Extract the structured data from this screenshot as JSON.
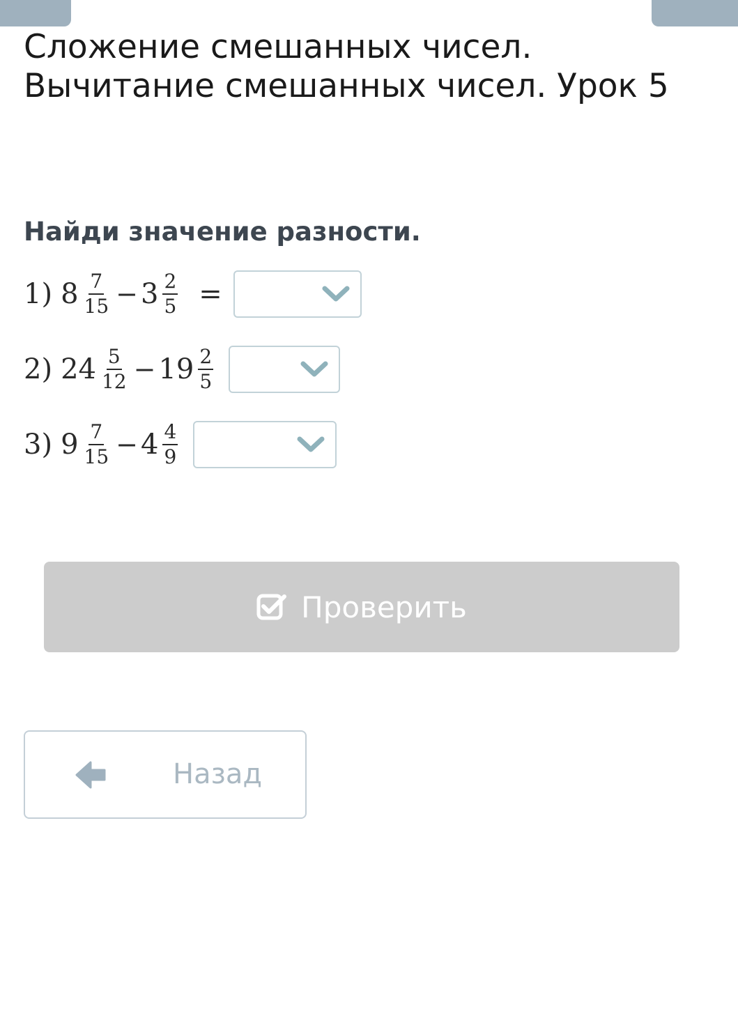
{
  "header": {
    "title": "Сложение смешанных чисел. Вычитание смешанных чисел. Урок 5"
  },
  "task": {
    "instruction": "Найди значение разности.",
    "items": [
      {
        "index": "1)",
        "minuend": {
          "whole": "8",
          "num": "7",
          "den": "15"
        },
        "minus": "−",
        "subtrahend": {
          "whole": "3",
          "num": "2",
          "den": "5"
        },
        "equals": "=",
        "answer": ""
      },
      {
        "index": "2)",
        "minuend": {
          "whole": "24",
          "num": "5",
          "den": "12"
        },
        "minus": "−",
        "subtrahend": {
          "whole": "19",
          "num": "2",
          "den": "5"
        },
        "answer": ""
      },
      {
        "index": "3)",
        "minuend": {
          "whole": "9",
          "num": "7",
          "den": "15"
        },
        "minus": "−",
        "subtrahend": {
          "whole": "4",
          "num": "4",
          "den": "9"
        },
        "answer": ""
      }
    ]
  },
  "actions": {
    "check_label": "Проверить",
    "back_label": "Назад"
  },
  "icons": {
    "check": "checkbox-checked-icon",
    "back": "arrow-left-icon",
    "dropdown": "chevron-down-icon"
  },
  "colors": {
    "top_tab": "#9fb1be",
    "check_button_bg": "#cccccc",
    "dropdown_chevron": "#8fb2bb",
    "back_text": "#aab8c2"
  }
}
